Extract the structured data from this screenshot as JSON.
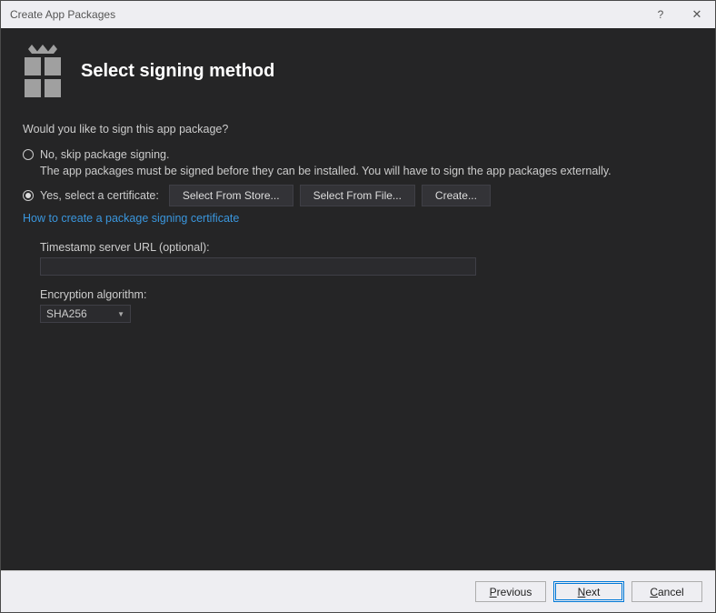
{
  "window": {
    "title": "Create App Packages",
    "help": "?",
    "close": "✕"
  },
  "header": {
    "title": "Select signing method"
  },
  "main": {
    "question": "Would you like to sign this app package?",
    "option_no": "No, skip package signing.",
    "option_no_helper": "The app packages must be signed before they can be installed. You will have to sign the app packages externally.",
    "option_yes": "Yes, select a certificate:",
    "selected": "yes",
    "btn_store": "Select From Store...",
    "btn_file": "Select From File...",
    "btn_create": "Create...",
    "link": "How to create a package signing certificate",
    "timestamp_label": "Timestamp server URL (optional):",
    "timestamp_value": "",
    "encryption_label": "Encryption algorithm:",
    "encryption_value": "SHA256"
  },
  "footer": {
    "previous": "revious",
    "previous_m": "P",
    "next": "ext",
    "next_m": "N",
    "cancel": "ancel",
    "cancel_m": "C"
  }
}
